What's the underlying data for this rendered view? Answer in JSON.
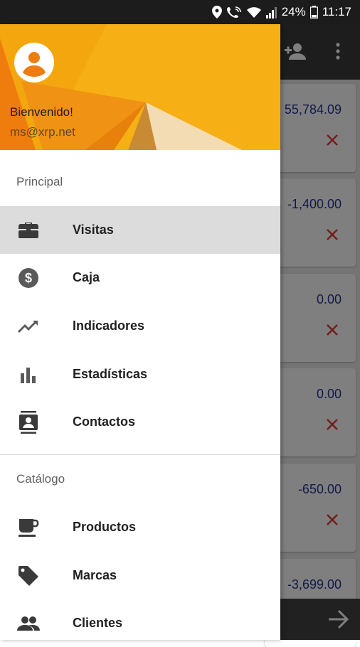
{
  "status_bar": {
    "battery_percent": "24%",
    "time": "11:17"
  },
  "drawer": {
    "header": {
      "welcome": "Bienvenido!",
      "email": "ms@xrp.net",
      "accent_color": "#f6b015"
    },
    "sections": [
      {
        "title": "Principal",
        "items": [
          {
            "label": "Visitas",
            "icon": "briefcase-icon",
            "selected": true
          },
          {
            "label": "Caja",
            "icon": "dollar-circle-icon",
            "selected": false
          },
          {
            "label": "Indicadores",
            "icon": "trending-up-icon",
            "selected": false
          },
          {
            "label": "Estadísticas",
            "icon": "bar-chart-icon",
            "selected": false
          },
          {
            "label": "Contactos",
            "icon": "contacts-icon",
            "selected": false
          }
        ]
      },
      {
        "title": "Catálogo",
        "items": [
          {
            "label": "Productos",
            "icon": "coffee-cup-icon",
            "selected": false
          },
          {
            "label": "Marcas",
            "icon": "tag-icon",
            "selected": false
          },
          {
            "label": "Clientes",
            "icon": "people-icon",
            "selected": false
          }
        ]
      }
    ]
  },
  "background": {
    "cards": [
      {
        "amount": "55,784.09"
      },
      {
        "amount": "-1,400.00"
      },
      {
        "amount": "0.00"
      },
      {
        "amount": "0.00"
      },
      {
        "amount": "-650.00"
      },
      {
        "amount": "-3,699.00"
      }
    ],
    "amount_color": "#283593",
    "remove_color": "#e53935"
  }
}
